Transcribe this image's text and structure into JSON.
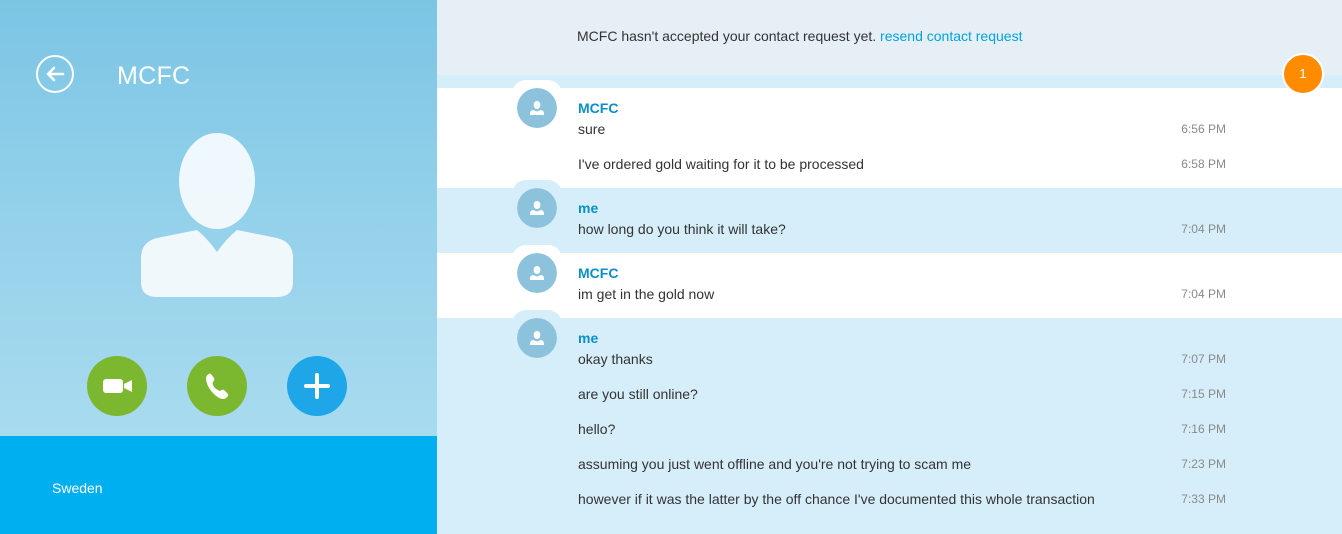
{
  "contact": {
    "name": "MCFC",
    "location": "Sweden"
  },
  "notice": {
    "text": "MCFC hasn't accepted your contact request yet.",
    "link": "resend contact request"
  },
  "unread_count": "1",
  "colors": {
    "accent": "#00aff0",
    "call_green": "#7cb82f",
    "add_blue": "#1ea6e8",
    "badge_orange": "#ff8c00",
    "sender_blue": "#0a8fc9",
    "link_blue": "#00a3e0"
  },
  "icons": {
    "back": "arrow-left-icon",
    "video": "video-camera-icon",
    "call": "phone-icon",
    "add": "plus-icon",
    "avatar": "default-person-icon"
  },
  "messages": [
    {
      "sender": "MCFC",
      "items": [
        {
          "text": "sure",
          "time": "6:56 PM"
        },
        {
          "text": "I've ordered gold waiting for it to be processed",
          "time": "6:58 PM"
        }
      ]
    },
    {
      "sender": "me",
      "items": [
        {
          "text": "how long do you think it will take?",
          "time": "7:04 PM"
        }
      ]
    },
    {
      "sender": "MCFC",
      "items": [
        {
          "text": "im get in the gold now",
          "time": "7:04 PM"
        }
      ]
    },
    {
      "sender": "me",
      "items": [
        {
          "text": "okay thanks",
          "time": "7:07 PM"
        },
        {
          "text": "are you still online?",
          "time": "7:15 PM"
        },
        {
          "text": "hello?",
          "time": "7:16 PM"
        },
        {
          "text": "assuming you just went offline and you're not trying to scam me",
          "time": "7:23 PM"
        },
        {
          "text": "however if it was the latter by the off chance I've documented this whole transaction",
          "time": "7:33 PM"
        }
      ]
    }
  ]
}
